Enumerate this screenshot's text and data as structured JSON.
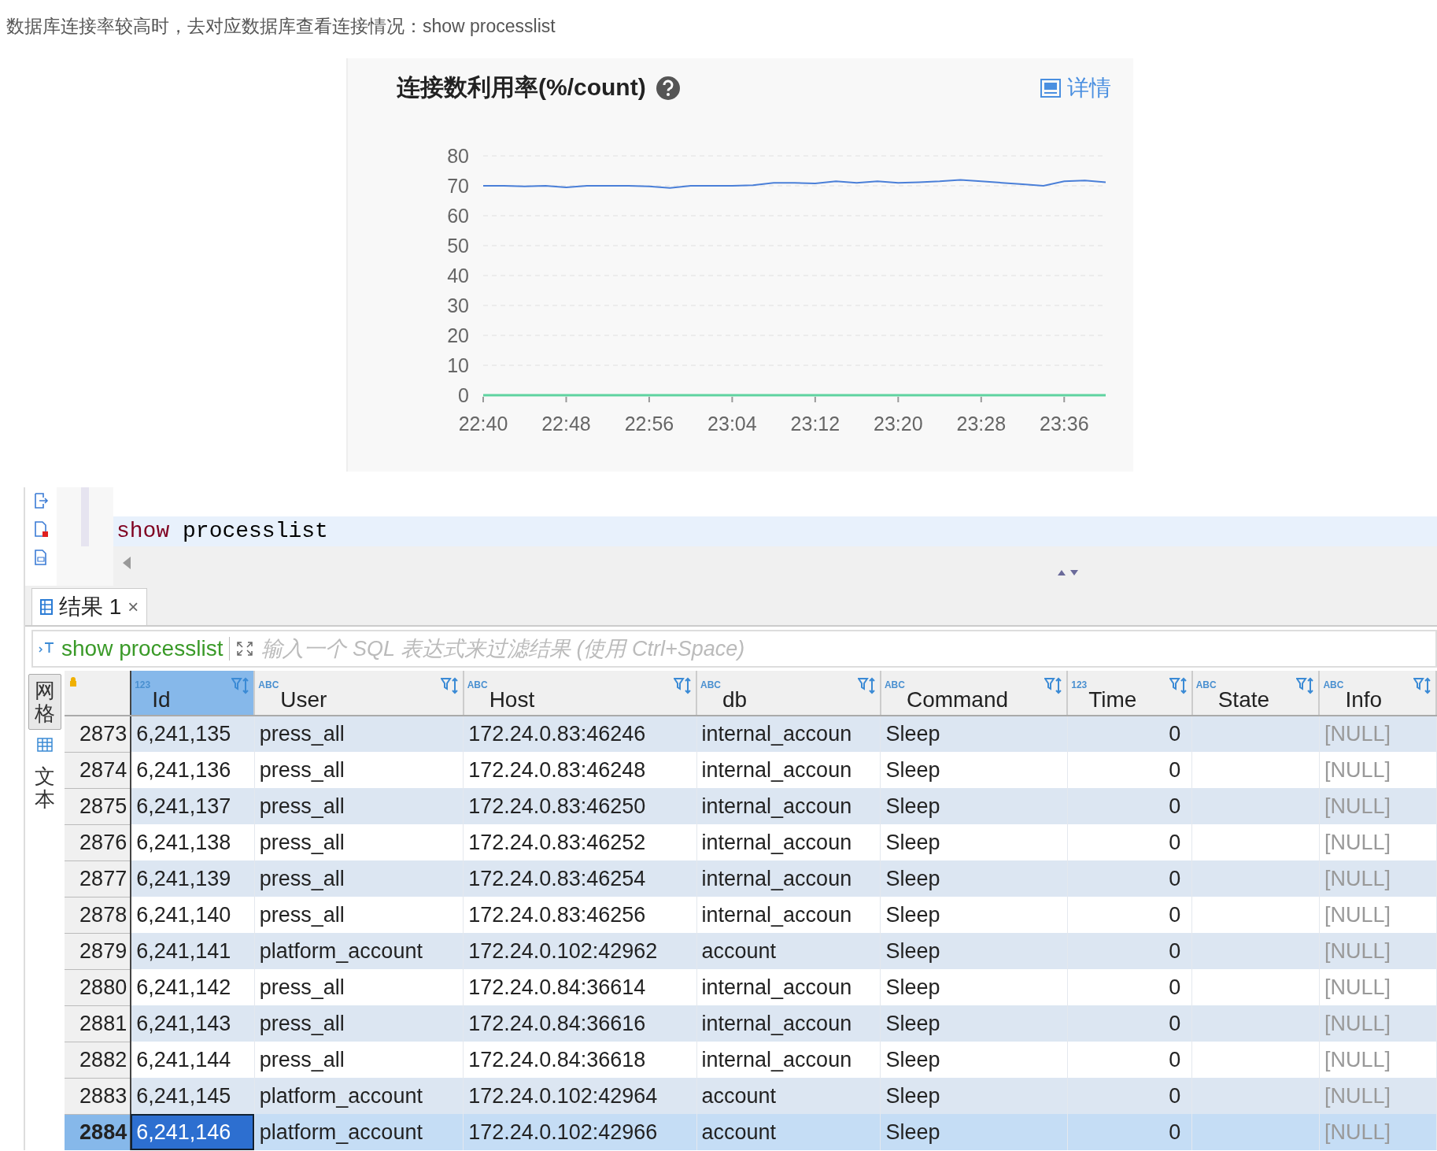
{
  "note": "数据库连接率较高时，去对应数据库查看连接情况：show processlist",
  "chart_panel": {
    "title": "连接数利用率(%/count)",
    "details_link": "详情",
    "chart_data": {
      "type": "line",
      "categories": [
        "22:40",
        null,
        null,
        null,
        "22:48",
        null,
        null,
        null,
        "22:56",
        null,
        null,
        null,
        "23:04",
        null,
        null,
        null,
        "23:12",
        null,
        null,
        null,
        "23:20",
        null,
        null,
        null,
        "23:28",
        null,
        null,
        null,
        "23:36",
        null,
        null
      ],
      "ylim": [
        0,
        80
      ],
      "grid": true,
      "yticks": [
        0,
        10,
        20,
        30,
        40,
        50,
        60,
        70,
        80
      ],
      "series": [
        {
          "color": "#4a7fd8",
          "values": [
            70,
            70,
            69.8,
            70,
            69.5,
            70,
            70,
            70,
            69.8,
            69.3,
            70,
            70,
            70,
            70.2,
            71,
            71,
            70.8,
            71.5,
            71,
            71.5,
            71,
            71.2,
            71.5,
            72,
            71.5,
            71,
            70.5,
            70,
            71.5,
            71.8,
            71.2
          ]
        },
        {
          "color": "#5fd3a0",
          "values": [
            0,
            0,
            0,
            0,
            0,
            0,
            0,
            0,
            0,
            0,
            0,
            0,
            0,
            0,
            0,
            0,
            0,
            0,
            0,
            0,
            0,
            0,
            0,
            0,
            0,
            0,
            0,
            0,
            0,
            0,
            0
          ]
        }
      ]
    }
  },
  "editor": {
    "keyword": "show",
    "code": "processlist"
  },
  "result_tab": {
    "label": "结果 1",
    "close": "×",
    "selected": true
  },
  "filter": {
    "query": "show processlist",
    "placeholder": "输入一个 SQL 表达式来过滤结果 (使用 Ctrl+Space)"
  },
  "view_tabs": [
    {
      "label": "网格",
      "selected": true
    },
    {
      "label": "文本",
      "selected": false
    }
  ],
  "table": {
    "columns": [
      {
        "label": "Id",
        "type": "123",
        "selected": true
      },
      {
        "label": "User",
        "type": "ABC",
        "selected": false
      },
      {
        "label": "Host",
        "type": "ABC",
        "selected": false
      },
      {
        "label": "db",
        "type": "ABC",
        "selected": false
      },
      {
        "label": "Command",
        "type": "ABC",
        "selected": false
      },
      {
        "label": "Time",
        "type": "123",
        "selected": false
      },
      {
        "label": "State",
        "type": "ABC",
        "selected": false
      },
      {
        "label": "Info",
        "type": "ABC",
        "selected": false
      }
    ],
    "rows": [
      {
        "num": "2873",
        "cells": [
          "6,241,135",
          "press_all",
          "172.24.0.83:46246",
          "internal_accoun",
          "Sleep",
          "0",
          "",
          "[NULL]"
        ],
        "selected": false
      },
      {
        "num": "2874",
        "cells": [
          "6,241,136",
          "press_all",
          "172.24.0.83:46248",
          "internal_accoun",
          "Sleep",
          "0",
          "",
          "[NULL]"
        ],
        "selected": false
      },
      {
        "num": "2875",
        "cells": [
          "6,241,137",
          "press_all",
          "172.24.0.83:46250",
          "internal_accoun",
          "Sleep",
          "0",
          "",
          "[NULL]"
        ],
        "selected": false
      },
      {
        "num": "2876",
        "cells": [
          "6,241,138",
          "press_all",
          "172.24.0.83:46252",
          "internal_accoun",
          "Sleep",
          "0",
          "",
          "[NULL]"
        ],
        "selected": false
      },
      {
        "num": "2877",
        "cells": [
          "6,241,139",
          "press_all",
          "172.24.0.83:46254",
          "internal_accoun",
          "Sleep",
          "0",
          "",
          "[NULL]"
        ],
        "selected": false
      },
      {
        "num": "2878",
        "cells": [
          "6,241,140",
          "press_all",
          "172.24.0.83:46256",
          "internal_accoun",
          "Sleep",
          "0",
          "",
          "[NULL]"
        ],
        "selected": false
      },
      {
        "num": "2879",
        "cells": [
          "6,241,141",
          "platform_account",
          "172.24.0.102:42962",
          "account",
          "Sleep",
          "0",
          "",
          "[NULL]"
        ],
        "selected": false
      },
      {
        "num": "2880",
        "cells": [
          "6,241,142",
          "press_all",
          "172.24.0.84:36614",
          "internal_accoun",
          "Sleep",
          "0",
          "",
          "[NULL]"
        ],
        "selected": false
      },
      {
        "num": "2881",
        "cells": [
          "6,241,143",
          "press_all",
          "172.24.0.84:36616",
          "internal_accoun",
          "Sleep",
          "0",
          "",
          "[NULL]"
        ],
        "selected": false
      },
      {
        "num": "2882",
        "cells": [
          "6,241,144",
          "press_all",
          "172.24.0.84:36618",
          "internal_accoun",
          "Sleep",
          "0",
          "",
          "[NULL]"
        ],
        "selected": false
      },
      {
        "num": "2883",
        "cells": [
          "6,241,145",
          "platform_account",
          "172.24.0.102:42964",
          "account",
          "Sleep",
          "0",
          "",
          "[NULL]"
        ],
        "selected": false
      },
      {
        "num": "2884",
        "cells": [
          "6,241,146",
          "platform_account",
          "172.24.0.102:42966",
          "account",
          "Sleep",
          "0",
          "",
          "[NULL]"
        ],
        "selected": true
      }
    ]
  }
}
